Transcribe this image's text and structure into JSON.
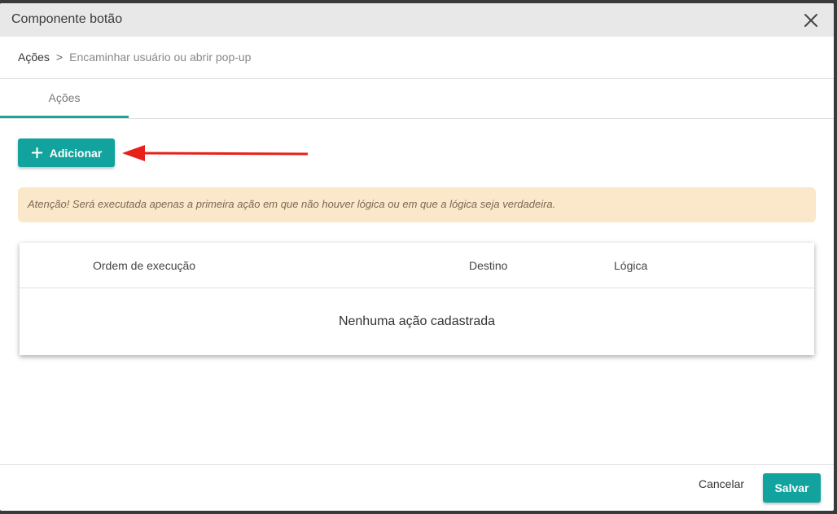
{
  "dialog": {
    "title": "Componente botão",
    "close_icon": "close-icon"
  },
  "breadcrumb": {
    "items": [
      "Ações",
      "Encaminhar usuário ou abrir pop-up"
    ],
    "separator": ">"
  },
  "tabs": [
    {
      "label": "Ações",
      "active": true
    }
  ],
  "toolbar": {
    "add_label": "Adicionar",
    "add_icon": "plus-icon"
  },
  "annotation": {
    "arrow_color": "#e8201a"
  },
  "alert": {
    "text": "Atenção! Será executada apenas a primeira ação em que não houver lógica ou em que a lógica seja verdadeira."
  },
  "table": {
    "columns": [
      "Ordem de execução",
      "Destino",
      "Lógica"
    ],
    "empty_message": "Nenhuma ação cadastrada"
  },
  "footer": {
    "cancel_label": "Cancelar",
    "save_label": "Salvar"
  },
  "colors": {
    "accent": "#12a39e",
    "alert_bg": "#fbe7c9",
    "titlebar_bg": "#e8e8e8"
  }
}
